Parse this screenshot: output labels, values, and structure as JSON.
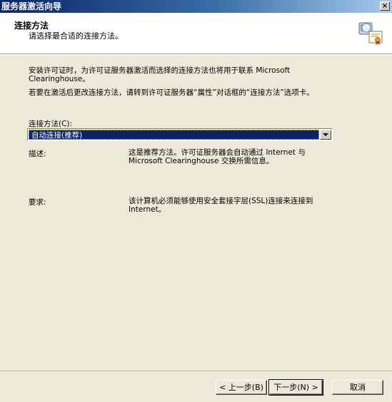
{
  "window": {
    "title": "服务器激活向导",
    "close_glyph": "×"
  },
  "header": {
    "title": "连接方法",
    "subtitle": "请选择最合适的连接方法。"
  },
  "body": {
    "para1": "安装许可证时，为许可证服务器激活而选择的连接方法也将用于联系 Microsoft Clearinghouse。",
    "para2": "若要在激活后更改连接方法，请转到许可证服务器“属性”对话框的“连接方法”选项卡。",
    "combo_label": "连接方法(C):",
    "combo_value": "自动连接(推荐)",
    "desc_label": "描述:",
    "desc_value": "这是推荐方法。许可证服务器会自动通过 Internet 与 Microsoft Clearinghouse 交换所需信息。",
    "req_label": "要求:",
    "req_value": "该计算机必须能够使用安全套接字层(SSL)连接来连接到 Internet。"
  },
  "buttons": {
    "back": "< 上一步(B)",
    "next": "下一步(N) >",
    "cancel": "取消"
  },
  "colors": {
    "accent": "#0a246a",
    "dialog_bg": "#ece9d8"
  },
  "icons": {
    "header": "certificate-server-icon"
  }
}
